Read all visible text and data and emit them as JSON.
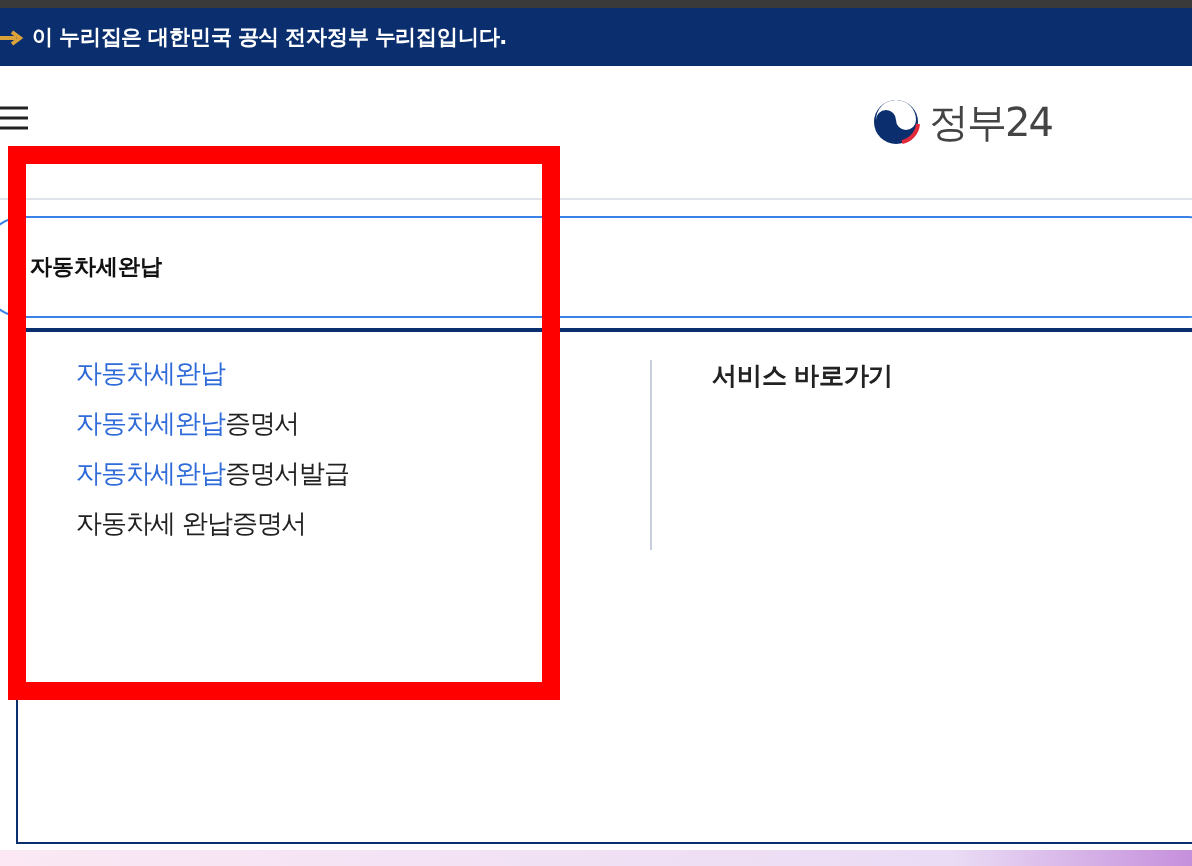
{
  "banner": {
    "text": "이 누리집은 대한민국 공식 전자정부 누리집입니다."
  },
  "header": {
    "logo_text": "정부24"
  },
  "search": {
    "value": "자동차세완납"
  },
  "suggestions": [
    {
      "match": "자동차세완납"
    },
    {
      "match": "자동차세완납",
      "rest": "증명서"
    },
    {
      "match": "자동차세완납",
      "rest": "증명서발급"
    },
    {
      "rest": "자동차세 완납증명서"
    }
  ],
  "shortcuts": {
    "title": "서비스 바로가기"
  }
}
